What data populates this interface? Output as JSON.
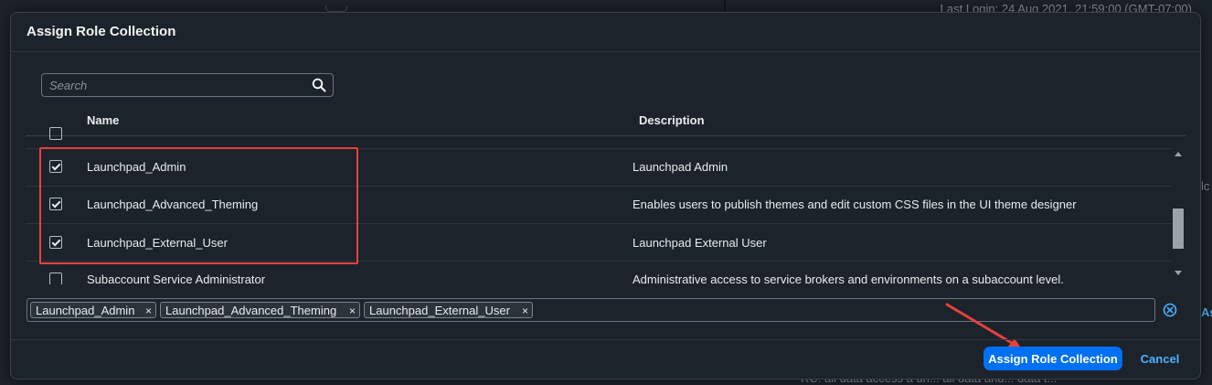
{
  "background": {
    "right_text": "Last Login:   24 Aug 2021, 21:59:00 (GMT-07:00)",
    "link_fragment": "As",
    "bottom_text": "RC: all data access a un... all data and... data t...",
    "fragment_lc": "lc"
  },
  "dialog": {
    "title": "Assign Role Collection",
    "search": {
      "placeholder": "Search",
      "value": ""
    },
    "columns": {
      "name": "Name",
      "description": "Description"
    },
    "rows": [
      {
        "name": "",
        "description": "",
        "checked": false
      },
      {
        "name": "Launchpad_Admin",
        "description": "Launchpad Admin",
        "checked": true
      },
      {
        "name": "Launchpad_Advanced_Theming",
        "description": "Enables users to publish themes and edit custom CSS files in the UI theme designer",
        "checked": true
      },
      {
        "name": "Launchpad_External_User",
        "description": "Launchpad External User",
        "checked": true
      },
      {
        "name": "Subaccount Service Administrator",
        "description": "Administrative access to service brokers and environments on a subaccount level.",
        "checked": false
      }
    ],
    "tokens": [
      "Launchpad_Admin",
      "Launchpad_Advanced_Theming",
      "Launchpad_External_User"
    ],
    "token_remove_glyph": "×",
    "buttons": {
      "assign": "Assign Role Collection",
      "cancel": "Cancel"
    }
  },
  "colors": {
    "primary_button": "#0070f2",
    "link": "#4db1ff",
    "highlight_annotation": "#e8413e",
    "background": "#1d232a"
  },
  "icons": {
    "search": "search-icon",
    "clear": "clear-all-icon",
    "arrow": "annotation-arrow-icon"
  }
}
